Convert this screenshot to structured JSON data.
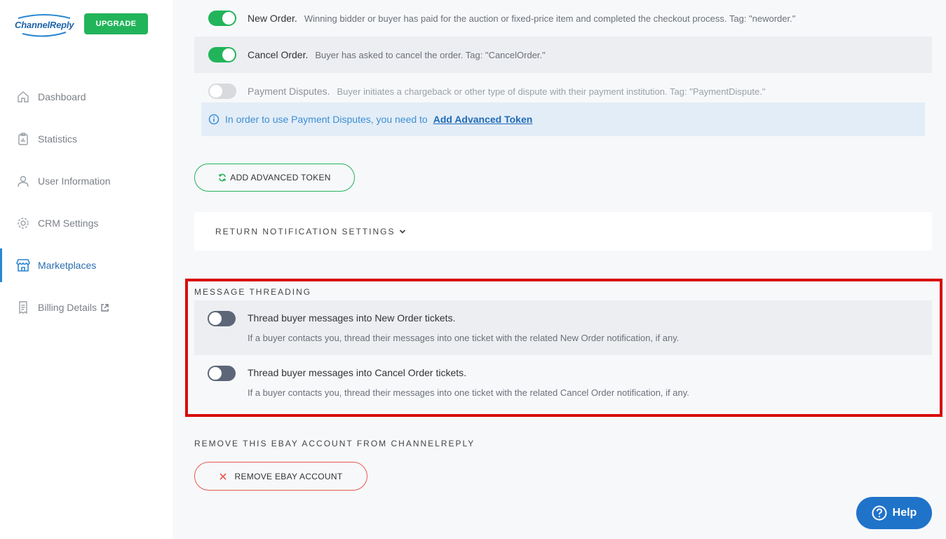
{
  "sidebar": {
    "logo_text": "ChannelReply",
    "upgrade_label": "UPGRADE",
    "items": [
      {
        "label": "Dashboard",
        "icon": "home-icon"
      },
      {
        "label": "Statistics",
        "icon": "clipboard-icon"
      },
      {
        "label": "User Information",
        "icon": "user-icon"
      },
      {
        "label": "CRM Settings",
        "icon": "gear-icon"
      },
      {
        "label": "Marketplaces",
        "icon": "store-icon",
        "active": true
      },
      {
        "label": "Billing Details",
        "icon": "receipt-icon",
        "external": true
      }
    ]
  },
  "notifications": [
    {
      "title": "New Order.",
      "desc": "Winning bidder or buyer has paid for the auction or fixed-price item and completed the checkout process. Tag: \"neworder.\"",
      "enabled": true
    },
    {
      "title": "Cancel Order.",
      "desc": "Buyer has asked to cancel the order. Tag: \"CancelOrder.\"",
      "enabled": true
    },
    {
      "title": "Payment Disputes.",
      "desc": "Buyer initiates a chargeback or other type of dispute with their payment institution. Tag: \"PaymentDispute.\"",
      "enabled": false,
      "disabled": true
    }
  ],
  "info": {
    "text": "In order to use Payment Disputes, you need to",
    "link": "Add Advanced Token"
  },
  "add_token_label": "ADD ADVANCED TOKEN",
  "return_settings_label": "RETURN NOTIFICATION SETTINGS",
  "threading": {
    "heading": "MESSAGE THREADING",
    "items": [
      {
        "title": "Thread buyer messages into New Order tickets.",
        "desc": "If a buyer contacts you, thread their messages into one ticket with the related New Order notification, if any.",
        "enabled": false
      },
      {
        "title": "Thread buyer messages into Cancel Order tickets.",
        "desc": "If a buyer contacts you, thread their messages into one ticket with the related Cancel Order notification, if any.",
        "enabled": false
      }
    ]
  },
  "remove": {
    "heading": "REMOVE THIS EBAY ACCOUNT FROM CHANNELREPLY",
    "button_label": "REMOVE EBAY ACCOUNT"
  },
  "help_label": "Help",
  "colors": {
    "accent_green": "#22b45a",
    "accent_blue": "#1f73c9",
    "highlight_red": "#d80c0c",
    "danger": "#e8584f"
  }
}
